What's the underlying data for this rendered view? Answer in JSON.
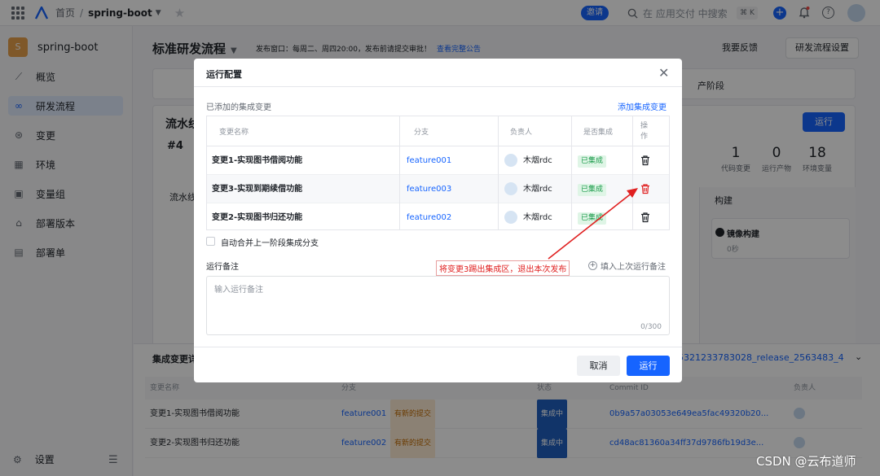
{
  "topbar": {
    "home": "首页",
    "project": "spring-boot",
    "invite": "邀请",
    "search_placeholder": "在 应用交付 中搜索",
    "shortcut": "⌘ K"
  },
  "sidebar": {
    "project_badge": "S",
    "project_name": "spring-boot",
    "items": [
      {
        "label": "概览",
        "icon": "chart-line-icon"
      },
      {
        "label": "研发流程",
        "icon": "infinity-icon"
      },
      {
        "label": "变更",
        "icon": "change-icon"
      },
      {
        "label": "环境",
        "icon": "grid-icon"
      },
      {
        "label": "变量组",
        "icon": "variable-icon"
      },
      {
        "label": "部署版本",
        "icon": "package-icon"
      },
      {
        "label": "部署单",
        "icon": "document-icon"
      }
    ],
    "settings": "设置"
  },
  "main": {
    "title": "标准研发流程",
    "release_note": "发布窗口：每周二、周四20:00，发布前请提交审批！",
    "release_link": "查看完整公告",
    "feedback": "我要反馈",
    "settings_button": "研发流程设置",
    "stage_text": "产阶段",
    "card_title": "流水线",
    "card_num": "#4",
    "run_button": "运行",
    "stats": [
      {
        "value": "1",
        "label": "代码变更"
      },
      {
        "value": "0",
        "label": "运行产物"
      },
      {
        "value": "18",
        "label": "环境变量"
      }
    ],
    "pipeline_label": "流水线",
    "build_title": "构建",
    "build_card_title": "镜像构建",
    "build_card_sub": "0秒"
  },
  "bottom_panel": {
    "title": "集成变更详",
    "release": "5321233783028_release_2563483_4",
    "headers": [
      "变更名称",
      "分支",
      "状态",
      "Commit ID",
      "负责人"
    ],
    "rows": [
      {
        "name": "变更1-实现图书借阅功能",
        "branch": "feature001",
        "branch_tag": "有新的提交",
        "status": "集成中",
        "commit": "0b9a57a03053e649ea5fac49320b20..."
      },
      {
        "name": "变更2-实现图书归还功能",
        "branch": "feature002",
        "branch_tag": "有新的提交",
        "status": "集成中",
        "commit": "cd48ac81360a34ff37d9786fb19d3e..."
      }
    ]
  },
  "modal": {
    "title": "运行配置",
    "section_label": "已添加的集成变更",
    "add_link": "添加集成变更",
    "headers": {
      "name": "变更名称",
      "branch": "分支",
      "owner": "负责人",
      "integrated": "是否集成",
      "action": "操作"
    },
    "rows": [
      {
        "name": "变更1-实现图书借阅功能",
        "branch": "feature001",
        "owner": "木烟rdc",
        "status": "已集成"
      },
      {
        "name": "变更3-实现到期续借功能",
        "branch": "feature003",
        "owner": "木烟rdc",
        "status": "已集成"
      },
      {
        "name": "变更2-实现图书归还功能",
        "branch": "feature002",
        "owner": "木烟rdc",
        "status": "已集成"
      }
    ],
    "checkbox_label": "自动合并上一阶段集成分支",
    "note_label": "运行备注",
    "prev_note": "填入上次运行备注",
    "note_placeholder": "输入运行备注",
    "note_count": "0/300",
    "cancel": "取消",
    "run": "运行"
  },
  "annotation": "将变更3踢出集成区，退出本次发布",
  "watermark": "CSDN @云布道师",
  "colors": {
    "accent": "#1664ff",
    "annotation": "#e02020",
    "success": "#1a9a4a"
  }
}
